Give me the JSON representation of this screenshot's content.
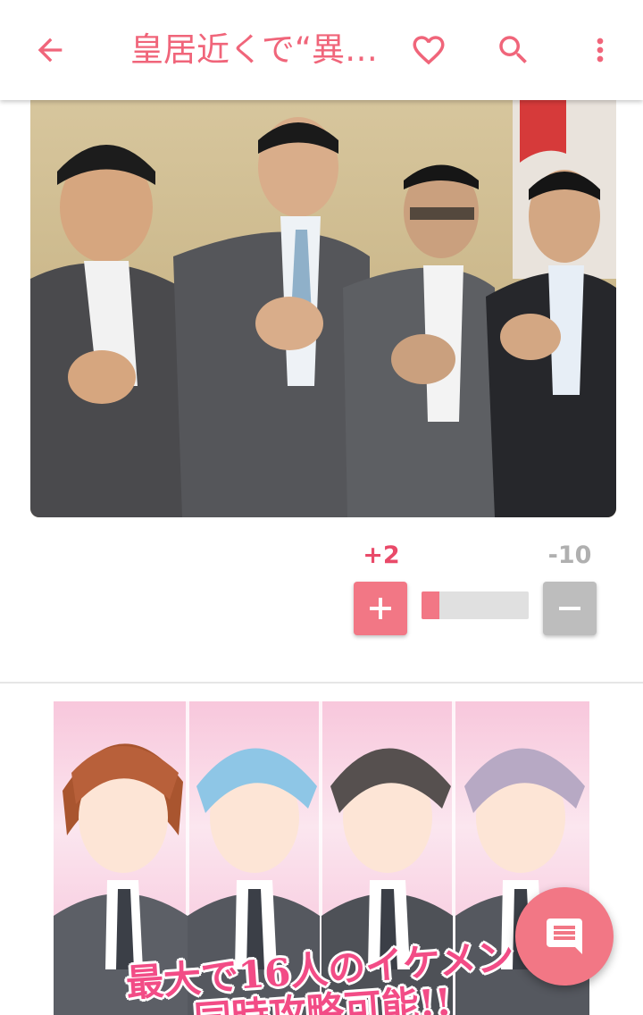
{
  "app": {
    "accent_color": "#f27785",
    "accent_text_color": "#f0657a"
  },
  "appbar": {
    "title": "皇居近くで“異…",
    "back_icon": "arrow-left-icon",
    "favorite_icon": "heart-outline-icon",
    "search_icon": "search-icon",
    "more_icon": "more-vertical-icon"
  },
  "article": {
    "photo_icon": "photo-group-icon"
  },
  "vote": {
    "plus_count": "+2",
    "minus_count": "-10",
    "plus_icon": "plus-icon",
    "minus_icon": "minus-icon",
    "ratio_fill": 0.17,
    "plus_color": "#f27785",
    "minus_color": "#bdbdbd"
  },
  "ad": {
    "caption_line1": "最大で16人のイケメン",
    "caption_line2": "同時攻略可能!!"
  },
  "fab": {
    "icon": "comment-icon"
  }
}
